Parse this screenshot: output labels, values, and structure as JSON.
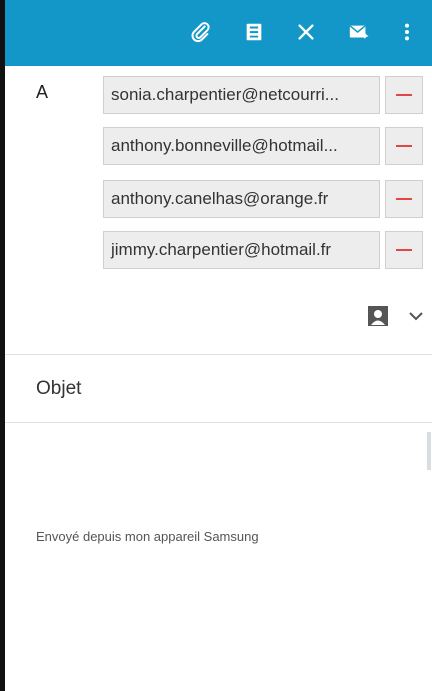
{
  "toolbar": {
    "color": "#1297c8",
    "actions": [
      {
        "icon": "paperclip-icon",
        "label": "attach"
      },
      {
        "icon": "save-icon",
        "label": "save"
      },
      {
        "icon": "close-icon",
        "label": "discard"
      },
      {
        "icon": "send-icon",
        "label": "send"
      },
      {
        "icon": "more-vert-icon",
        "label": "more"
      }
    ]
  },
  "to": {
    "label": "A",
    "recipients": [
      "sonia.charpentier@netcourri...",
      "anthony.bonneville@hotmail...",
      "anthony.canelhas@orange.fr",
      "jimmy.charpentier@hotmail.fr"
    ]
  },
  "subject": {
    "placeholder": "Objet"
  },
  "body": {
    "signature": "Envoyé depuis mon appareil Samsung"
  }
}
